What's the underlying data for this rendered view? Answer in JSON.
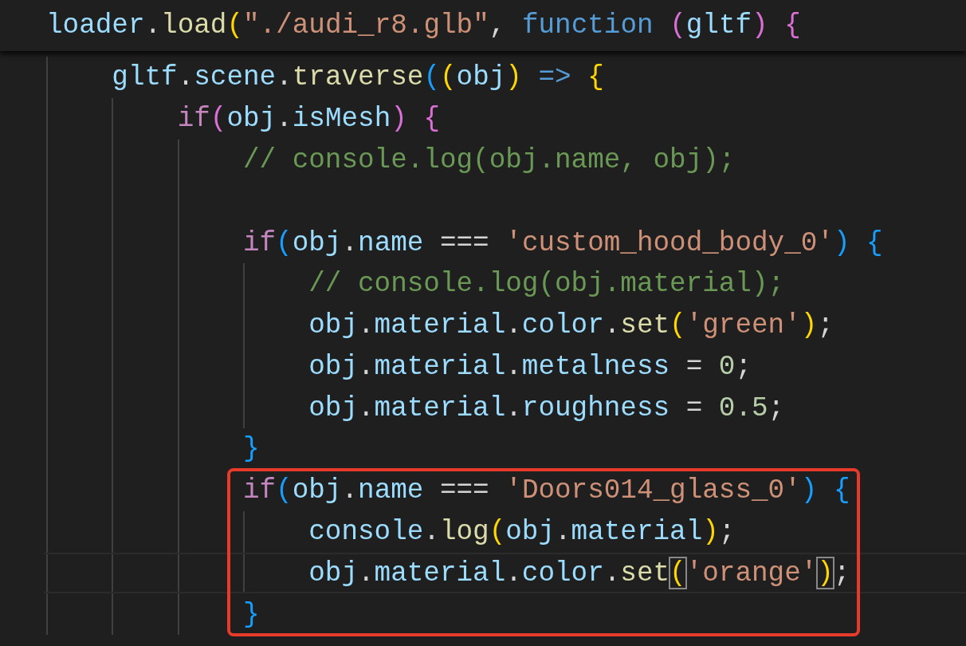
{
  "sticky_header": {
    "tokens": [
      {
        "text": "loader",
        "kind": "var"
      },
      {
        "text": ".",
        "kind": "op"
      },
      {
        "text": "load",
        "kind": "fn"
      },
      {
        "text": "(",
        "kind": "b1"
      },
      {
        "text": "\"./audi_r8.glb\"",
        "kind": "str"
      },
      {
        "text": ", ",
        "kind": "op"
      },
      {
        "text": "function",
        "kind": "storage"
      },
      {
        "text": " (",
        "kind": "b2"
      },
      {
        "text": "gltf",
        "kind": "var"
      },
      {
        "text": ")",
        "kind": "b2"
      },
      {
        "text": " {",
        "kind": "b2"
      }
    ]
  },
  "lines": [
    {
      "tokens": [
        {
          "text": "gltf",
          "kind": "var"
        },
        {
          "text": ".",
          "kind": "op"
        },
        {
          "text": "scene",
          "kind": "var"
        },
        {
          "text": ".",
          "kind": "op"
        },
        {
          "text": "traverse",
          "kind": "fn"
        },
        {
          "text": "(",
          "kind": "b3"
        },
        {
          "text": "(",
          "kind": "b1"
        },
        {
          "text": "obj",
          "kind": "var"
        },
        {
          "text": ")",
          "kind": "b1"
        },
        {
          "text": " =>",
          "kind": "storage"
        },
        {
          "text": " {",
          "kind": "b1"
        }
      ],
      "children": [
        {
          "tokens": [
            {
              "text": "if",
              "kind": "kw"
            },
            {
              "text": "(",
              "kind": "b2"
            },
            {
              "text": "obj",
              "kind": "var"
            },
            {
              "text": ".",
              "kind": "op"
            },
            {
              "text": "isMesh",
              "kind": "var"
            },
            {
              "text": ")",
              "kind": "b2"
            },
            {
              "text": " {",
              "kind": "b2"
            }
          ],
          "children": [
            {
              "tokens": [
                {
                  "text": "// console.log(obj.name, obj);",
                  "kind": "comment"
                }
              ]
            },
            {
              "blank_line_before": true,
              "tokens": [
                {
                  "text": "if",
                  "kind": "kw"
                },
                {
                  "text": "(",
                  "kind": "b3"
                },
                {
                  "text": "obj",
                  "kind": "var"
                },
                {
                  "text": ".",
                  "kind": "op"
                },
                {
                  "text": "name",
                  "kind": "var"
                },
                {
                  "text": " === ",
                  "kind": "op"
                },
                {
                  "text": "'custom_hood_body_0'",
                  "kind": "str"
                },
                {
                  "text": ")",
                  "kind": "b3"
                },
                {
                  "text": " {",
                  "kind": "b3"
                }
              ],
              "children": [
                {
                  "tokens": [
                    {
                      "text": "// console.log(obj.material);",
                      "kind": "comment"
                    }
                  ]
                },
                {
                  "tokens": [
                    {
                      "text": "obj",
                      "kind": "var"
                    },
                    {
                      "text": ".",
                      "kind": "op"
                    },
                    {
                      "text": "material",
                      "kind": "var"
                    },
                    {
                      "text": ".",
                      "kind": "op"
                    },
                    {
                      "text": "color",
                      "kind": "var"
                    },
                    {
                      "text": ".",
                      "kind": "op"
                    },
                    {
                      "text": "set",
                      "kind": "fn"
                    },
                    {
                      "text": "(",
                      "kind": "b1"
                    },
                    {
                      "text": "'green'",
                      "kind": "str"
                    },
                    {
                      "text": ")",
                      "kind": "b1"
                    },
                    {
                      "text": ";",
                      "kind": "op"
                    }
                  ]
                },
                {
                  "tokens": [
                    {
                      "text": "obj",
                      "kind": "var"
                    },
                    {
                      "text": ".",
                      "kind": "op"
                    },
                    {
                      "text": "material",
                      "kind": "var"
                    },
                    {
                      "text": ".",
                      "kind": "op"
                    },
                    {
                      "text": "metalness",
                      "kind": "var"
                    },
                    {
                      "text": " = ",
                      "kind": "op"
                    },
                    {
                      "text": "0",
                      "kind": "num"
                    },
                    {
                      "text": ";",
                      "kind": "op"
                    }
                  ]
                },
                {
                  "tokens": [
                    {
                      "text": "obj",
                      "kind": "var"
                    },
                    {
                      "text": ".",
                      "kind": "op"
                    },
                    {
                      "text": "material",
                      "kind": "var"
                    },
                    {
                      "text": ".",
                      "kind": "op"
                    },
                    {
                      "text": "roughness",
                      "kind": "var"
                    },
                    {
                      "text": " = ",
                      "kind": "op"
                    },
                    {
                      "text": "0.5",
                      "kind": "num"
                    },
                    {
                      "text": ";",
                      "kind": "op"
                    }
                  ]
                }
              ],
              "closing": [
                {
                  "text": "}",
                  "kind": "b3"
                }
              ]
            },
            {
              "boxed": true,
              "tokens": [
                {
                  "text": "if",
                  "kind": "kw"
                },
                {
                  "text": "(",
                  "kind": "b3"
                },
                {
                  "text": "obj",
                  "kind": "var"
                },
                {
                  "text": ".",
                  "kind": "op"
                },
                {
                  "text": "name",
                  "kind": "var"
                },
                {
                  "text": " === ",
                  "kind": "op"
                },
                {
                  "text": "'Doors014_glass_0'",
                  "kind": "str"
                },
                {
                  "text": ")",
                  "kind": "b3"
                },
                {
                  "text": " {",
                  "kind": "b3"
                }
              ],
              "children": [
                {
                  "tokens": [
                    {
                      "text": "console",
                      "kind": "var"
                    },
                    {
                      "text": ".",
                      "kind": "op"
                    },
                    {
                      "text": "log",
                      "kind": "fn"
                    },
                    {
                      "text": "(",
                      "kind": "b1"
                    },
                    {
                      "text": "obj",
                      "kind": "var"
                    },
                    {
                      "text": ".",
                      "kind": "op"
                    },
                    {
                      "text": "material",
                      "kind": "var"
                    },
                    {
                      "text": ")",
                      "kind": "b1"
                    },
                    {
                      "text": ";",
                      "kind": "op"
                    }
                  ]
                },
                {
                  "current": true,
                  "tokens": [
                    {
                      "text": "obj",
                      "kind": "var"
                    },
                    {
                      "text": ".",
                      "kind": "op"
                    },
                    {
                      "text": "material",
                      "kind": "var"
                    },
                    {
                      "text": ".",
                      "kind": "op"
                    },
                    {
                      "text": "color",
                      "kind": "var"
                    },
                    {
                      "text": ".",
                      "kind": "op"
                    },
                    {
                      "text": "set",
                      "kind": "fn"
                    },
                    {
                      "text": "(",
                      "kind": "b1",
                      "matched": true
                    },
                    {
                      "text": "'orange'",
                      "kind": "str"
                    },
                    {
                      "text": ")",
                      "kind": "b1",
                      "matched": true
                    },
                    {
                      "text": ";",
                      "kind": "op"
                    }
                  ]
                }
              ],
              "closing": [
                {
                  "text": "}",
                  "kind": "b3"
                }
              ]
            }
          ]
        }
      ]
    }
  ]
}
